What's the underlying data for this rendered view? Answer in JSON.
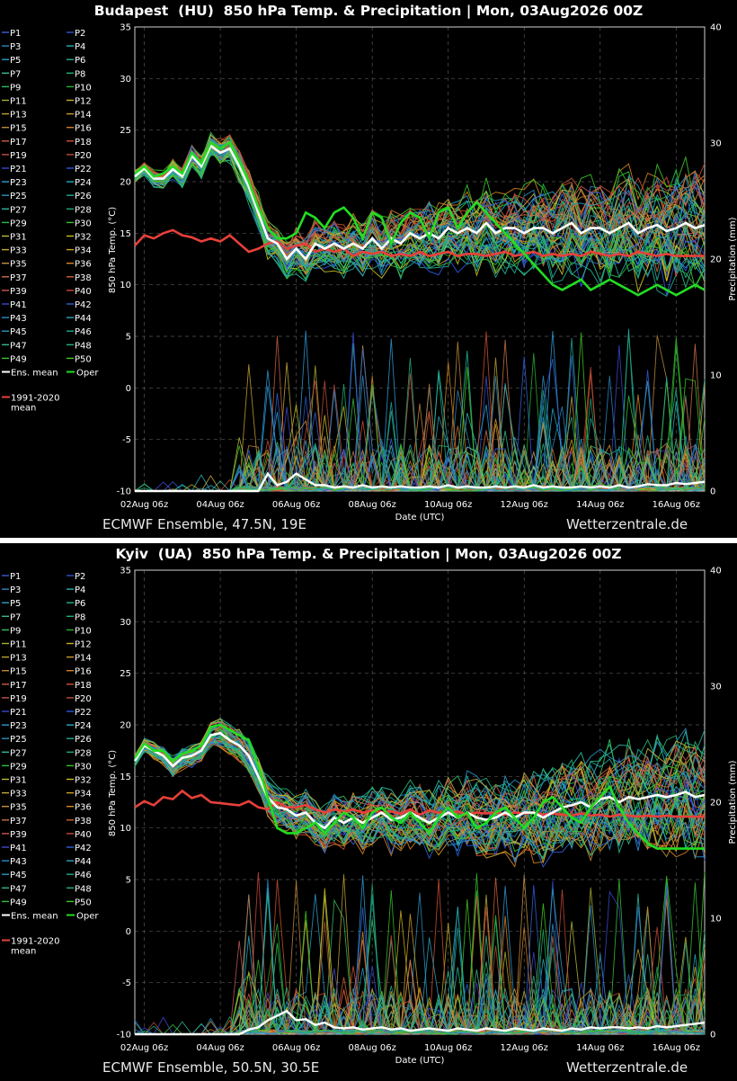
{
  "chart_data": [
    {
      "type": "line",
      "title": "Budapest  (HU)  850 hPa Temp. & Precipitation | Mon, 03Aug2026 00Z",
      "xlabel": "Date (UTC)",
      "ylabel": "850 hPa Temp. (°C)",
      "y2label": "Precipitation (mm)",
      "ylim": [
        -10,
        35
      ],
      "y2lim": [
        0,
        40
      ],
      "yticks": [
        "35",
        "30",
        "25",
        "20",
        "15",
        "10",
        "5",
        "0",
        "-5",
        "-10"
      ],
      "y2ticks": [
        "40",
        "30",
        "20",
        "10",
        "0"
      ],
      "x_ticks": [
        "02Aug 06z",
        "04Aug 06z",
        "06Aug 06z",
        "08Aug 06z",
        "10Aug 06z",
        "12Aug 06z",
        "14Aug 06z",
        "16Aug 06z"
      ],
      "grid": true,
      "legend_position": "left",
      "footer_left": "ECMWF Ensemble, 47.5N, 19E",
      "footer_right": "Wetterzentrale.de",
      "x_hours": [
        0,
        6,
        12,
        18,
        24,
        30,
        36,
        42,
        48,
        54,
        60,
        66,
        72,
        78,
        84,
        90,
        96,
        102,
        108,
        114,
        120,
        126,
        132,
        138,
        144,
        150,
        156,
        162,
        168,
        174,
        180,
        186,
        192,
        198,
        204,
        210,
        216,
        222,
        228,
        234,
        240,
        246,
        252,
        258,
        264,
        270,
        276,
        282,
        288,
        294,
        300,
        306,
        312,
        318,
        324,
        330,
        336,
        342,
        348,
        354,
        360
      ],
      "temp_mean": [
        20.5,
        21.3,
        20.3,
        20.3,
        21.2,
        20.5,
        22.5,
        21.5,
        23.5,
        22.8,
        23.2,
        21.5,
        19.5,
        17,
        14.5,
        14,
        12.5,
        13.5,
        12.5,
        14,
        13.5,
        14,
        13.5,
        14,
        13.5,
        14.5,
        13.5,
        14.5,
        14,
        15,
        14.5,
        15,
        14.5,
        15.5,
        15,
        15.5,
        15,
        16,
        15,
        15.5,
        15.5,
        15,
        15.5,
        15.5,
        15,
        15.5,
        16,
        15,
        15.5,
        15.5,
        15,
        15.5,
        16,
        15,
        15.5,
        15.8,
        15.2,
        15.5,
        16,
        15.5,
        15.8
      ],
      "temp_oper": [
        20.8,
        21.5,
        20.5,
        20.8,
        21.5,
        20.8,
        22.8,
        21.8,
        23.8,
        23.2,
        23.8,
        22,
        20,
        17.5,
        15.5,
        14.5,
        14.5,
        15,
        17,
        16.5,
        15.5,
        17,
        17.5,
        16.5,
        14.5,
        17,
        16.5,
        14,
        16,
        17,
        16.5,
        14.5,
        17,
        17.5,
        15.5,
        17,
        18,
        17,
        16,
        15,
        14,
        13,
        12,
        11,
        10,
        9.5,
        10,
        10.5,
        9.5,
        10,
        10.5,
        10,
        9.5,
        9,
        9.5,
        10,
        9.5,
        9,
        9.5,
        10,
        9.5
      ],
      "temp_clim": [
        13.8,
        14.8,
        14.5,
        15,
        15.3,
        14.8,
        14.6,
        14.2,
        14.5,
        14.2,
        14.8,
        14,
        13.2,
        13.5,
        14,
        14.2,
        13.5,
        13.8,
        14,
        13.2,
        13.5,
        13.2,
        13.5,
        12.8,
        13.2,
        13,
        13.2,
        12.8,
        13,
        12.8,
        13.2,
        12.8,
        13,
        13.2,
        12.8,
        13,
        13,
        12.8,
        13,
        13.2,
        12.8,
        13,
        13.2,
        12.8,
        13,
        12.8,
        13,
        12.8,
        13.2,
        13,
        12.8,
        13,
        12.8,
        13.2,
        13,
        12.8,
        13,
        12.8,
        12.8,
        12.8,
        12.8
      ],
      "precip_mean": [
        0,
        0,
        0,
        0,
        0,
        0,
        0,
        0,
        0,
        0,
        0,
        0,
        0,
        0,
        1.5,
        0.5,
        0.8,
        1.5,
        1,
        0.5,
        0.5,
        0.3,
        0.4,
        0.3,
        0.5,
        0.3,
        0.4,
        0.3,
        0.4,
        0.3,
        0.3,
        0.4,
        0.3,
        0.5,
        0.3,
        0.4,
        0.3,
        0.3,
        0.4,
        0.3,
        0.4,
        0.3,
        0.5,
        0.3,
        0.4,
        0.3,
        0.3,
        0.4,
        0.3,
        0.4,
        0.3,
        0.5,
        0.3,
        0.4,
        0.6,
        0.5,
        0.5,
        0.7,
        0.6,
        0.7,
        0.8
      ],
      "ensemble_members": 50,
      "seed": 7
    },
    {
      "type": "line",
      "title": "Kyiv  (UA)  850 hPa Temp. & Precipitation | Mon, 03Aug2026 00Z",
      "xlabel": "Date (UTC)",
      "ylabel": "850 hPa Temp. (°C)",
      "y2label": "Precipitation (mm)",
      "ylim": [
        -10,
        35
      ],
      "y2lim": [
        0,
        40
      ],
      "yticks": [
        "35",
        "30",
        "25",
        "20",
        "15",
        "10",
        "5",
        "0",
        "-5",
        "-10"
      ],
      "y2ticks": [
        "40",
        "30",
        "20",
        "10",
        "0"
      ],
      "x_ticks": [
        "02Aug 06z",
        "04Aug 06z",
        "06Aug 06z",
        "08Aug 06z",
        "10Aug 06z",
        "12Aug 06z",
        "14Aug 06z",
        "16Aug 06z"
      ],
      "grid": true,
      "legend_position": "left",
      "footer_left": "ECMWF Ensemble, 50.5N, 30.5E",
      "footer_right": "Wetterzentrale.de",
      "x_hours": [
        0,
        6,
        12,
        18,
        24,
        30,
        36,
        42,
        48,
        54,
        60,
        66,
        72,
        78,
        84,
        90,
        96,
        102,
        108,
        114,
        120,
        126,
        132,
        138,
        144,
        150,
        156,
        162,
        168,
        174,
        180,
        186,
        192,
        198,
        204,
        210,
        216,
        222,
        228,
        234,
        240,
        246,
        252,
        258,
        264,
        270,
        276,
        282,
        288,
        294,
        300,
        306,
        312,
        318,
        324,
        330,
        336,
        342,
        348,
        354,
        360
      ],
      "temp_mean": [
        16.5,
        18,
        17.5,
        17,
        16,
        16.8,
        17,
        17.5,
        19,
        19.2,
        18.5,
        18,
        17,
        15,
        13,
        12,
        11.8,
        11.2,
        11.5,
        10.5,
        10,
        11,
        10.5,
        11,
        10.5,
        11,
        11.5,
        10.8,
        11,
        11.5,
        11,
        10.5,
        11,
        11.5,
        11,
        11.5,
        11,
        10.8,
        11,
        11.5,
        11,
        11.5,
        11.5,
        11,
        11.5,
        12,
        12.2,
        12.5,
        12,
        12.8,
        13,
        12.5,
        13,
        12.8,
        13,
        13.2,
        13,
        13.2,
        13.5,
        13,
        13.2
      ],
      "temp_oper": [
        16.8,
        18.2,
        17.5,
        17.5,
        16.5,
        17.2,
        17.5,
        18,
        19.8,
        20,
        19.5,
        19,
        18.5,
        16,
        13,
        10,
        9.5,
        9.5,
        10,
        10.5,
        9.5,
        10.5,
        11.5,
        11,
        10,
        11.5,
        12,
        11,
        10.5,
        11.5,
        10.5,
        9.5,
        11,
        12,
        11,
        11.5,
        10,
        10.5,
        11.5,
        12,
        11,
        10,
        11,
        12.5,
        13,
        12,
        11,
        10.5,
        12,
        13,
        14,
        12,
        10.5,
        9.5,
        8.5,
        8,
        8,
        8,
        8,
        8,
        8
      ],
      "temp_clim": [
        12,
        12.6,
        12.2,
        13,
        12.8,
        13.6,
        12.9,
        13.2,
        12.5,
        12.4,
        12.3,
        12.2,
        12.6,
        12,
        11.8,
        12.5,
        12,
        12,
        12.2,
        11.8,
        11.5,
        11.8,
        11.6,
        11.8,
        11.5,
        11.7,
        11.5,
        11.6,
        11.4,
        11.8,
        11.3,
        11.7,
        11.5,
        11.4,
        11.6,
        11.3,
        11.5,
        11.4,
        11.5,
        11.3,
        11.5,
        11.4,
        11.5,
        11.3,
        11.4,
        11.3,
        11.2,
        11.4,
        11.2,
        11.3,
        11.1,
        11.3,
        11.2,
        11.1,
        11.2,
        11.1,
        11.2,
        11.1,
        11.1,
        11.1,
        11.1
      ],
      "precip_mean": [
        0,
        0,
        0,
        0,
        0,
        0,
        0,
        0,
        0,
        0,
        0,
        0,
        0.4,
        0.6,
        1.2,
        1.6,
        2,
        1.2,
        1.3,
        0.8,
        1,
        0.6,
        0.5,
        0.6,
        0.4,
        0.5,
        0.6,
        0.4,
        0.5,
        0.3,
        0.4,
        0.5,
        0.4,
        0.3,
        0.5,
        0.4,
        0.3,
        0.5,
        0.4,
        0.3,
        0.5,
        0.4,
        0.3,
        0.5,
        0.4,
        0.3,
        0.5,
        0.4,
        0.6,
        0.5,
        0.6,
        0.6,
        0.5,
        0.6,
        0.5,
        0.7,
        0.6,
        0.7,
        0.8,
        0.9,
        1
      ],
      "ensemble_members": 50,
      "seed": 19
    }
  ],
  "legend": {
    "members": [
      "P1",
      "P2",
      "P3",
      "P4",
      "P5",
      "P6",
      "P7",
      "P8",
      "P9",
      "P10",
      "P11",
      "P12",
      "P13",
      "P14",
      "P15",
      "P16",
      "P17",
      "P18",
      "P19",
      "P20",
      "P21",
      "P22",
      "P23",
      "P24",
      "P25",
      "P26",
      "P27",
      "P28",
      "P29",
      "P30",
      "P31",
      "P32",
      "P33",
      "P34",
      "P35",
      "P36",
      "P37",
      "P38",
      "P39",
      "P40",
      "P41",
      "P42",
      "P43",
      "P44",
      "P45",
      "P46",
      "P47",
      "P48",
      "P49",
      "P50"
    ],
    "ens_mean": "Ens. mean",
    "oper": "Oper",
    "clim_line1": "1991-2020",
    "clim_line2": "mean"
  },
  "colors": {
    "background": "#000000",
    "grid": "#555555",
    "ens_mean": "#ffffff",
    "oper": "#22dd22",
    "clim": "#e8403a",
    "members": [
      "#3a5fd8",
      "#2b56c8",
      "#2a86c2",
      "#2bb0b0",
      "#2a9ec8",
      "#20b090",
      "#3ab890",
      "#20b070",
      "#30c060",
      "#28b030",
      "#a8b030",
      "#c8b020",
      "#c0a030",
      "#d09828",
      "#c08838",
      "#d08020",
      "#c86040",
      "#d05030",
      "#c05050",
      "#b85030",
      "#3a48d0",
      "#2a58e0",
      "#3098d8",
      "#28a8c8",
      "#2a90c0",
      "#20a898",
      "#28b8a0",
      "#18a878",
      "#28c040",
      "#38c028",
      "#b8b838",
      "#c8c020",
      "#c8a838",
      "#d0a020",
      "#c89040",
      "#d88820",
      "#c87048",
      "#d06030",
      "#c85858",
      "#c84838",
      "#4048d0",
      "#3060d8",
      "#2890d0",
      "#30a0c0",
      "#2898c0",
      "#20a890",
      "#30b888",
      "#20b080",
      "#38c038",
      "#40c820"
    ]
  }
}
